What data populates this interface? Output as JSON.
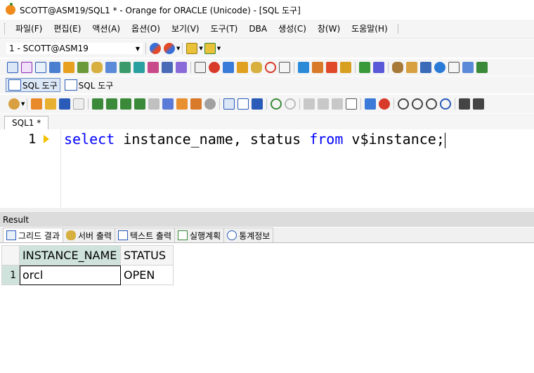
{
  "window": {
    "title": "SCOTT@ASM19/SQL1 * - Orange for ORACLE (Unicode) - [SQL 도구]"
  },
  "menu": [
    "파일(F)",
    "편집(E)",
    "액션(A)",
    "옵션(O)",
    "보기(V)",
    "도구(T)",
    "DBA",
    "생성(C)",
    "창(W)",
    "도움말(H)"
  ],
  "connection": {
    "selected": "1 - SCOTT@ASM19"
  },
  "tool_tabs": {
    "sql_tool_active": "SQL 도구",
    "sql_tool_inactive": "SQL 도구"
  },
  "editor": {
    "tab_label": "SQL1 *",
    "line_number": "1",
    "code": {
      "kw1": "select",
      "part1": " instance_name, status ",
      "kw2": "from",
      "part2": " v$instance;"
    }
  },
  "result": {
    "header": "Result",
    "tabs": [
      "그리드 결과",
      "서버 출력",
      "텍스트 출력",
      "실행계획",
      "통계정보"
    ],
    "columns": [
      "INSTANCE_NAME",
      "STATUS"
    ],
    "rows": [
      {
        "num": "1",
        "cells": [
          "orcl",
          "OPEN"
        ]
      }
    ]
  },
  "colors": {
    "keyword": "#0000ff",
    "selected_header": "#cfe3dc",
    "app_orange": "#f08a1c"
  }
}
